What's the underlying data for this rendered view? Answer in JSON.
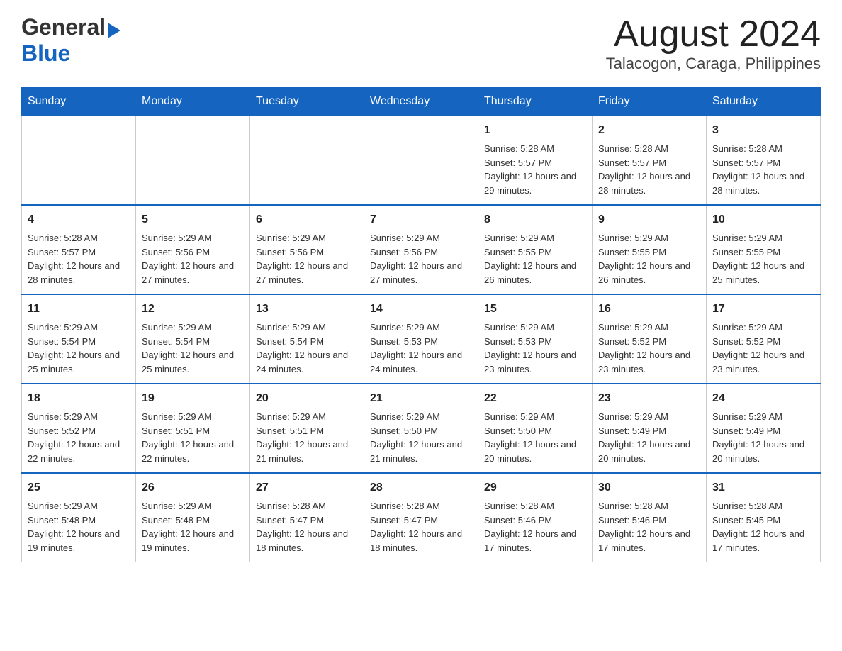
{
  "header": {
    "logo_general": "General",
    "logo_blue": "Blue",
    "month_year": "August 2024",
    "location": "Talacogon, Caraga, Philippines"
  },
  "weekdays": [
    "Sunday",
    "Monday",
    "Tuesday",
    "Wednesday",
    "Thursday",
    "Friday",
    "Saturday"
  ],
  "weeks": [
    [
      {
        "day": "",
        "info": ""
      },
      {
        "day": "",
        "info": ""
      },
      {
        "day": "",
        "info": ""
      },
      {
        "day": "",
        "info": ""
      },
      {
        "day": "1",
        "sunrise": "5:28 AM",
        "sunset": "5:57 PM",
        "daylight": "12 hours and 29 minutes."
      },
      {
        "day": "2",
        "sunrise": "5:28 AM",
        "sunset": "5:57 PM",
        "daylight": "12 hours and 28 minutes."
      },
      {
        "day": "3",
        "sunrise": "5:28 AM",
        "sunset": "5:57 PM",
        "daylight": "12 hours and 28 minutes."
      }
    ],
    [
      {
        "day": "4",
        "sunrise": "5:28 AM",
        "sunset": "5:57 PM",
        "daylight": "12 hours and 28 minutes."
      },
      {
        "day": "5",
        "sunrise": "5:29 AM",
        "sunset": "5:56 PM",
        "daylight": "12 hours and 27 minutes."
      },
      {
        "day": "6",
        "sunrise": "5:29 AM",
        "sunset": "5:56 PM",
        "daylight": "12 hours and 27 minutes."
      },
      {
        "day": "7",
        "sunrise": "5:29 AM",
        "sunset": "5:56 PM",
        "daylight": "12 hours and 27 minutes."
      },
      {
        "day": "8",
        "sunrise": "5:29 AM",
        "sunset": "5:55 PM",
        "daylight": "12 hours and 26 minutes."
      },
      {
        "day": "9",
        "sunrise": "5:29 AM",
        "sunset": "5:55 PM",
        "daylight": "12 hours and 26 minutes."
      },
      {
        "day": "10",
        "sunrise": "5:29 AM",
        "sunset": "5:55 PM",
        "daylight": "12 hours and 25 minutes."
      }
    ],
    [
      {
        "day": "11",
        "sunrise": "5:29 AM",
        "sunset": "5:54 PM",
        "daylight": "12 hours and 25 minutes."
      },
      {
        "day": "12",
        "sunrise": "5:29 AM",
        "sunset": "5:54 PM",
        "daylight": "12 hours and 25 minutes."
      },
      {
        "day": "13",
        "sunrise": "5:29 AM",
        "sunset": "5:54 PM",
        "daylight": "12 hours and 24 minutes."
      },
      {
        "day": "14",
        "sunrise": "5:29 AM",
        "sunset": "5:53 PM",
        "daylight": "12 hours and 24 minutes."
      },
      {
        "day": "15",
        "sunrise": "5:29 AM",
        "sunset": "5:53 PM",
        "daylight": "12 hours and 23 minutes."
      },
      {
        "day": "16",
        "sunrise": "5:29 AM",
        "sunset": "5:52 PM",
        "daylight": "12 hours and 23 minutes."
      },
      {
        "day": "17",
        "sunrise": "5:29 AM",
        "sunset": "5:52 PM",
        "daylight": "12 hours and 23 minutes."
      }
    ],
    [
      {
        "day": "18",
        "sunrise": "5:29 AM",
        "sunset": "5:52 PM",
        "daylight": "12 hours and 22 minutes."
      },
      {
        "day": "19",
        "sunrise": "5:29 AM",
        "sunset": "5:51 PM",
        "daylight": "12 hours and 22 minutes."
      },
      {
        "day": "20",
        "sunrise": "5:29 AM",
        "sunset": "5:51 PM",
        "daylight": "12 hours and 21 minutes."
      },
      {
        "day": "21",
        "sunrise": "5:29 AM",
        "sunset": "5:50 PM",
        "daylight": "12 hours and 21 minutes."
      },
      {
        "day": "22",
        "sunrise": "5:29 AM",
        "sunset": "5:50 PM",
        "daylight": "12 hours and 20 minutes."
      },
      {
        "day": "23",
        "sunrise": "5:29 AM",
        "sunset": "5:49 PM",
        "daylight": "12 hours and 20 minutes."
      },
      {
        "day": "24",
        "sunrise": "5:29 AM",
        "sunset": "5:49 PM",
        "daylight": "12 hours and 20 minutes."
      }
    ],
    [
      {
        "day": "25",
        "sunrise": "5:29 AM",
        "sunset": "5:48 PM",
        "daylight": "12 hours and 19 minutes."
      },
      {
        "day": "26",
        "sunrise": "5:29 AM",
        "sunset": "5:48 PM",
        "daylight": "12 hours and 19 minutes."
      },
      {
        "day": "27",
        "sunrise": "5:28 AM",
        "sunset": "5:47 PM",
        "daylight": "12 hours and 18 minutes."
      },
      {
        "day": "28",
        "sunrise": "5:28 AM",
        "sunset": "5:47 PM",
        "daylight": "12 hours and 18 minutes."
      },
      {
        "day": "29",
        "sunrise": "5:28 AM",
        "sunset": "5:46 PM",
        "daylight": "12 hours and 17 minutes."
      },
      {
        "day": "30",
        "sunrise": "5:28 AM",
        "sunset": "5:46 PM",
        "daylight": "12 hours and 17 minutes."
      },
      {
        "day": "31",
        "sunrise": "5:28 AM",
        "sunset": "5:45 PM",
        "daylight": "12 hours and 17 minutes."
      }
    ]
  ],
  "labels": {
    "sunrise_prefix": "Sunrise: ",
    "sunset_prefix": "Sunset: ",
    "daylight_prefix": "Daylight: "
  }
}
